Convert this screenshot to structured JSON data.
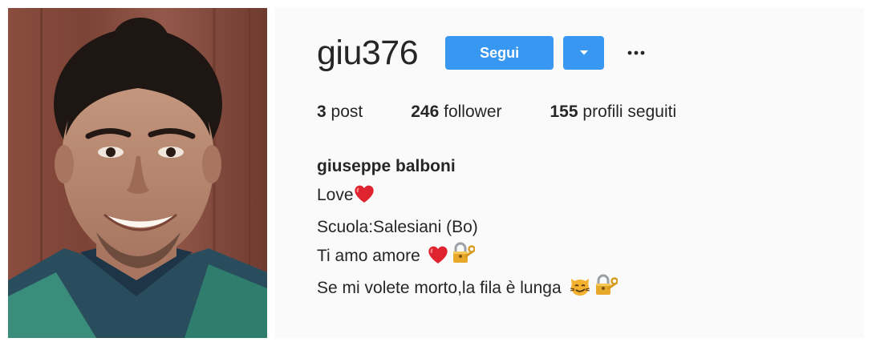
{
  "profile": {
    "username": "giu376",
    "follow_label": "Segui",
    "more_glyph": "•••",
    "photo_alt": "profile photo"
  },
  "stats": {
    "posts_count": "3",
    "posts_label": "post",
    "followers_count": "246",
    "followers_label": "follower",
    "following_count": "155",
    "following_label": "profili seguiti"
  },
  "bio": {
    "full_name": "giuseppe balboni",
    "line1": "Love",
    "line2": "Scuola:Salesiani (Bo)",
    "line3": "Ti amo amore",
    "line4": "Se mi volete morto,la fila è lunga"
  },
  "colors": {
    "accent": "#3897f0",
    "panel_bg": "#fafafa",
    "text": "#262626"
  },
  "icons": {
    "dropdown": "chevron-down-icon",
    "more": "more-dots-icon",
    "heart": "heart-icon",
    "lock": "lock-key-icon",
    "cat": "smirking-cat-icon"
  }
}
